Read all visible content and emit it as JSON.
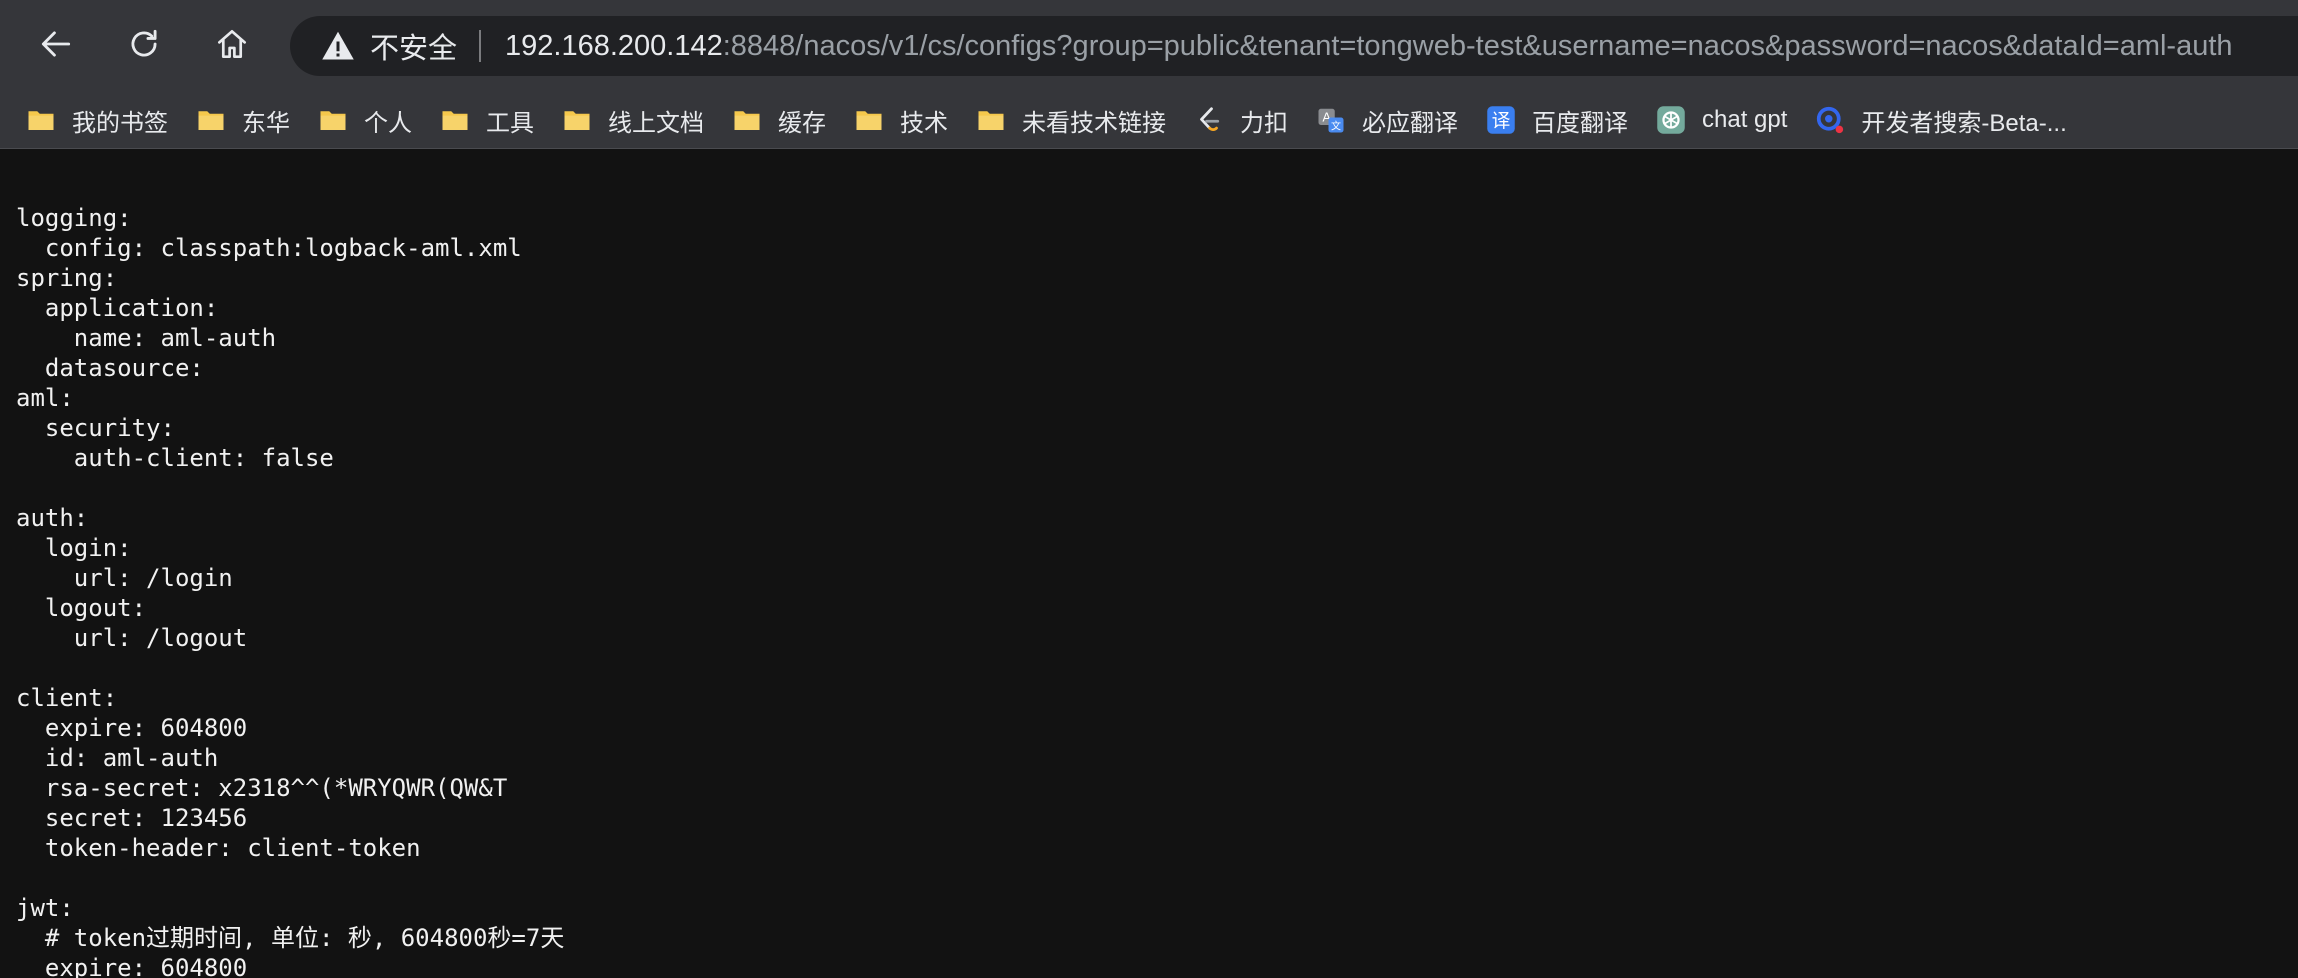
{
  "browser": {
    "nav": {
      "back_icon": "arrow-left-icon",
      "reload_icon": "reload-icon",
      "home_icon": "home-icon"
    },
    "omnibox": {
      "security_icon": "warning-triangle-icon",
      "security_label": "不安全",
      "url_host": "192.168.200.142",
      "url_rest": ":8848/nacos/v1/cs/configs?group=public&tenant=tongweb-test&username=nacos&password=nacos&dataId=aml-auth"
    },
    "bookmarks": [
      {
        "label": "我的书签",
        "icon": "folder-icon"
      },
      {
        "label": "东华",
        "icon": "folder-icon"
      },
      {
        "label": "个人",
        "icon": "folder-icon"
      },
      {
        "label": "工具",
        "icon": "folder-icon"
      },
      {
        "label": "线上文档",
        "icon": "folder-icon"
      },
      {
        "label": "缓存",
        "icon": "folder-icon"
      },
      {
        "label": "技术",
        "icon": "folder-icon"
      },
      {
        "label": "未看技术链接",
        "icon": "folder-icon"
      },
      {
        "label": "力扣",
        "icon": "leetcode-icon"
      },
      {
        "label": "必应翻译",
        "icon": "bing-translate-icon"
      },
      {
        "label": "百度翻译",
        "icon": "baidu-translate-icon"
      },
      {
        "label": "chat gpt",
        "icon": "chatgpt-icon"
      },
      {
        "label": "开发者搜索-Beta-...",
        "icon": "dev-search-icon"
      }
    ],
    "colors": {
      "toolbar": "#35363a",
      "omnibox": "#202124",
      "page_background": "#121212",
      "folder": "#f5c84c"
    }
  },
  "document": {
    "lines": [
      "logging:",
      "  config: classpath:logback-aml.xml",
      "spring:",
      "  application:",
      "    name: aml-auth",
      "  datasource:",
      "aml:",
      "  security:",
      "    auth-client: false",
      "",
      "auth:",
      "  login:",
      "    url: /login",
      "  logout:",
      "    url: /logout",
      "",
      "client:",
      "  expire: 604800",
      "  id: aml-auth",
      "  rsa-secret: x2318^^(*WRYQWR(QW&T",
      "  secret: 123456",
      "  token-header: client-token",
      "",
      "jwt:",
      "  # token过期时间, 单位: 秒, 604800秒=7天",
      "  expire: 604800"
    ]
  }
}
